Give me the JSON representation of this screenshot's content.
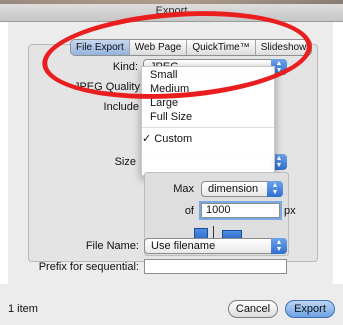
{
  "window": {
    "title": "Export"
  },
  "tabs": [
    "File Export",
    "Web Page",
    "QuickTime™",
    "Slideshow"
  ],
  "form": {
    "kind_label": "Kind:",
    "kind_value": "JPEG",
    "quality_label": "JPEG Quality",
    "include_label": "Include",
    "size_label": "Size",
    "max_label": "Max",
    "max_value": "dimension",
    "of_label": "of",
    "of_value": "1000",
    "px_label": "px",
    "filename_label": "File Name:",
    "filename_value": "Use filename",
    "prefix_label": "Prefix for sequential:",
    "prefix_value": ""
  },
  "size_menu": {
    "items": [
      "Small",
      "Medium",
      "Large",
      "Full Size"
    ],
    "selected": "✓ Custom"
  },
  "footer": {
    "item_count": "1 item",
    "cancel_label": "Cancel",
    "export_label": "Export"
  },
  "colors": {
    "accent": "#3d7be0",
    "annotation": "#ea1e1e"
  }
}
